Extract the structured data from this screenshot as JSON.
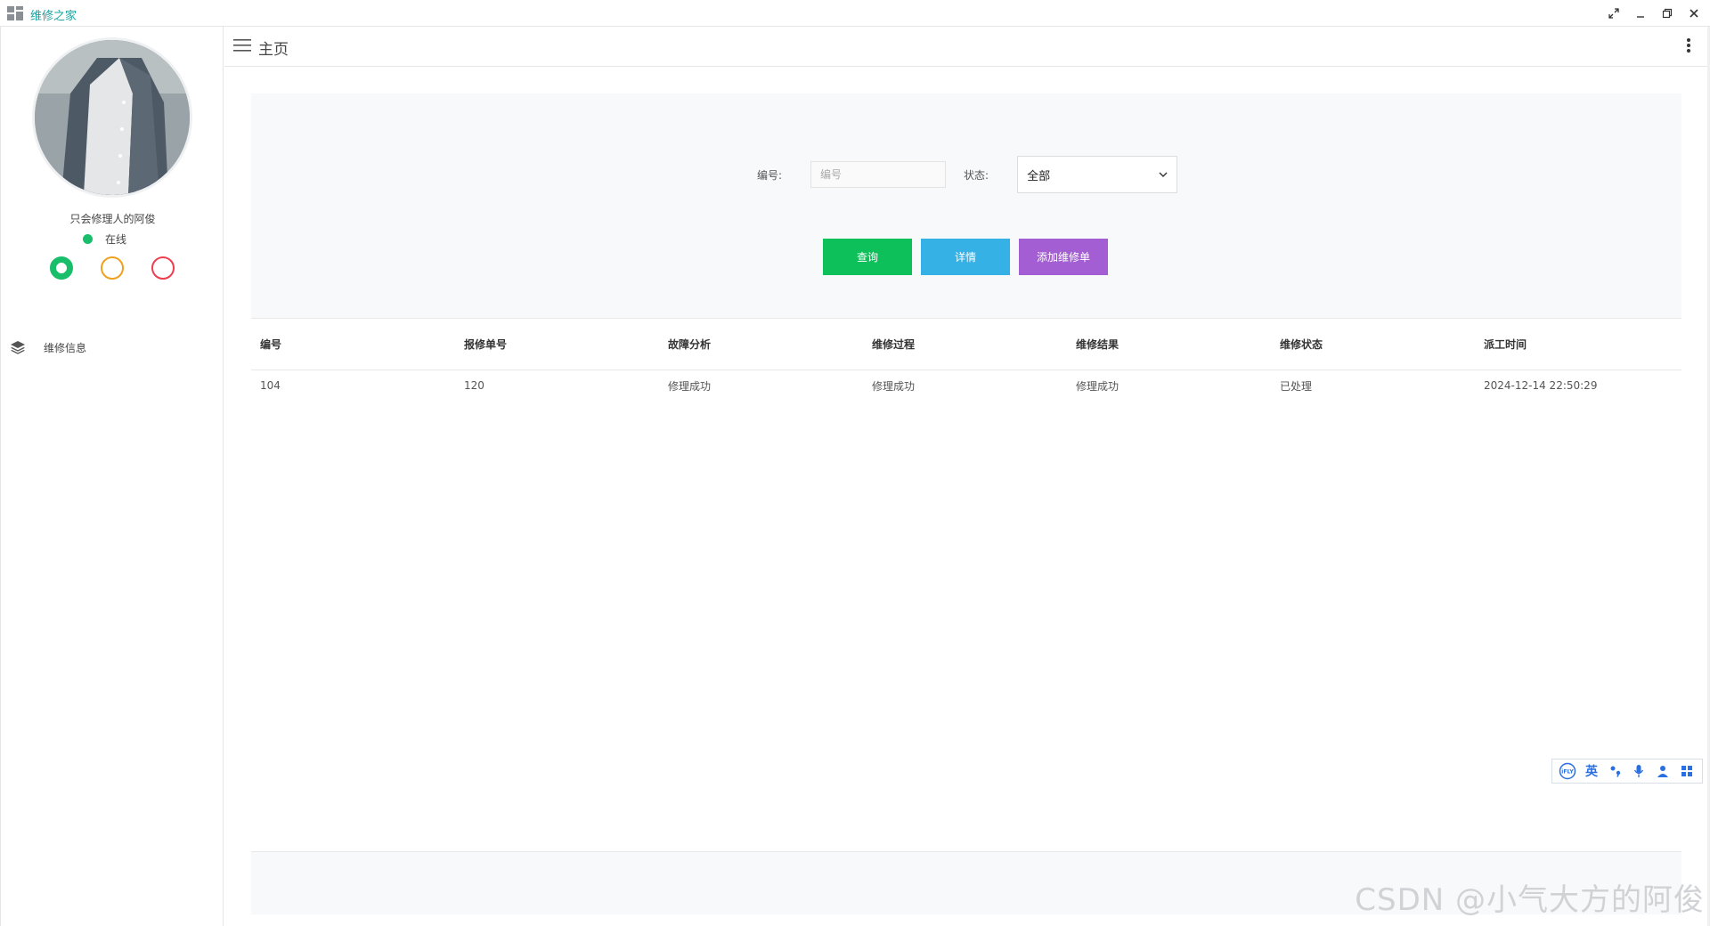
{
  "window": {
    "title": "维修之家",
    "controls": [
      "fullscreen-icon",
      "minimize-icon",
      "restore-icon",
      "close-icon"
    ]
  },
  "sidebar": {
    "username": "只会修理人的阿俊",
    "status_text": "在线",
    "status_colors": [
      "#19be6b",
      "#f0a020",
      "#ed3f4f"
    ],
    "menu": [
      {
        "label": "维修信息",
        "icon": "layers-icon"
      }
    ]
  },
  "header": {
    "title": "主页",
    "menu_icon": "hamburger-icon",
    "more_icon": "more-vertical-icon"
  },
  "search": {
    "id_label": "编号:",
    "id_placeholder": "编号",
    "id_value": "",
    "status_label": "状态:",
    "status_selected": "全部"
  },
  "buttons": {
    "query": "查询",
    "detail": "详情",
    "add": "添加维修单"
  },
  "table": {
    "headers": [
      "编号",
      "报修单号",
      "故障分析",
      "维修过程",
      "维修结果",
      "维修状态",
      "派工时间"
    ],
    "rows": [
      [
        "104",
        "120",
        "修理成功",
        "修理成功",
        "修理成功",
        "已处理",
        "2024-12-14 22:50:29"
      ]
    ]
  },
  "ime": {
    "logo": "iFLY",
    "lang": "英",
    "icons": [
      "punctuation-icon",
      "microphone-icon",
      "user-icon",
      "grid-icon"
    ]
  },
  "watermark": "CSDN @小气大方的阿俊",
  "colors": {
    "accent_teal": "#1aa3a3",
    "btn_green": "#0dc05a",
    "btn_blue": "#36b1e6",
    "btn_purple": "#a35ed3",
    "panel_bg": "#f8f9fa"
  }
}
